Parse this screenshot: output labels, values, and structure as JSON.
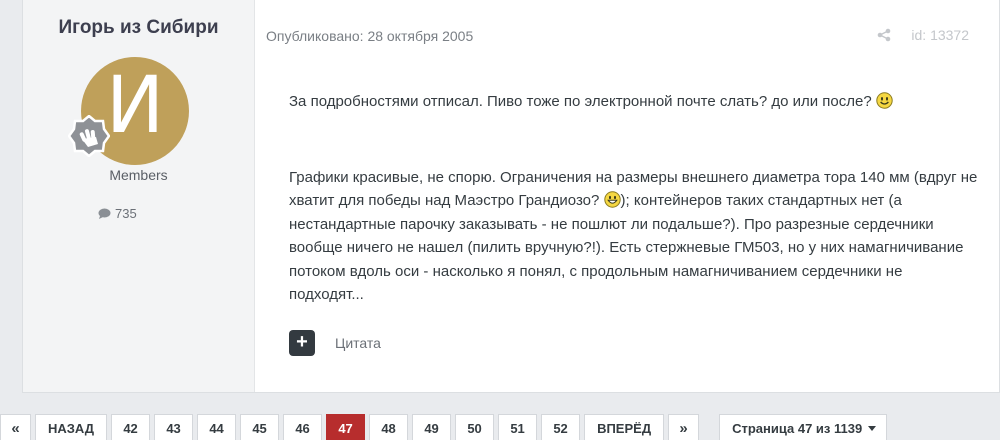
{
  "author": {
    "name": "Игорь из Сибири",
    "avatar_letter": "И",
    "group": "Members",
    "post_count": "735"
  },
  "post": {
    "date": "Опубликовано: 28 октября 2005",
    "post_id": "id: 13372",
    "paragraph1": "За подробностями отписал. Пиво тоже по электронной почте слать? до или после?",
    "paragraph2_part1": "Графики красивые, не спорю. Ограничения на размеры внешнего диаметра тора 140 мм (вдруг не хватит для победы над Маэстро Грандиозо?",
    "paragraph2_part2": "); контейнеров таких стандартных нет (а нестандартные парочку заказывать - не пошлют ли подальше?). Про разрезные сердечники вообще ничего не нашел (пилить вручную?!). Есть стержневые ГМ503, но у них намагничивание потоком вдоль оси - насколько я понял, с продольным намагничиванием сердечники не подходят...",
    "quote_label": "Цитата"
  },
  "pagination": {
    "first": "«",
    "prev": "НАЗАД",
    "pages": [
      "42",
      "43",
      "44",
      "45",
      "46",
      "47",
      "48",
      "49",
      "50",
      "51",
      "52"
    ],
    "active": "47",
    "next": "ВПЕРЁД",
    "last": "»",
    "jump_label": "Страница 47 из 1139"
  },
  "colors": {
    "accent": "#b72d2d",
    "avatar_bg": "#bfa05a"
  }
}
